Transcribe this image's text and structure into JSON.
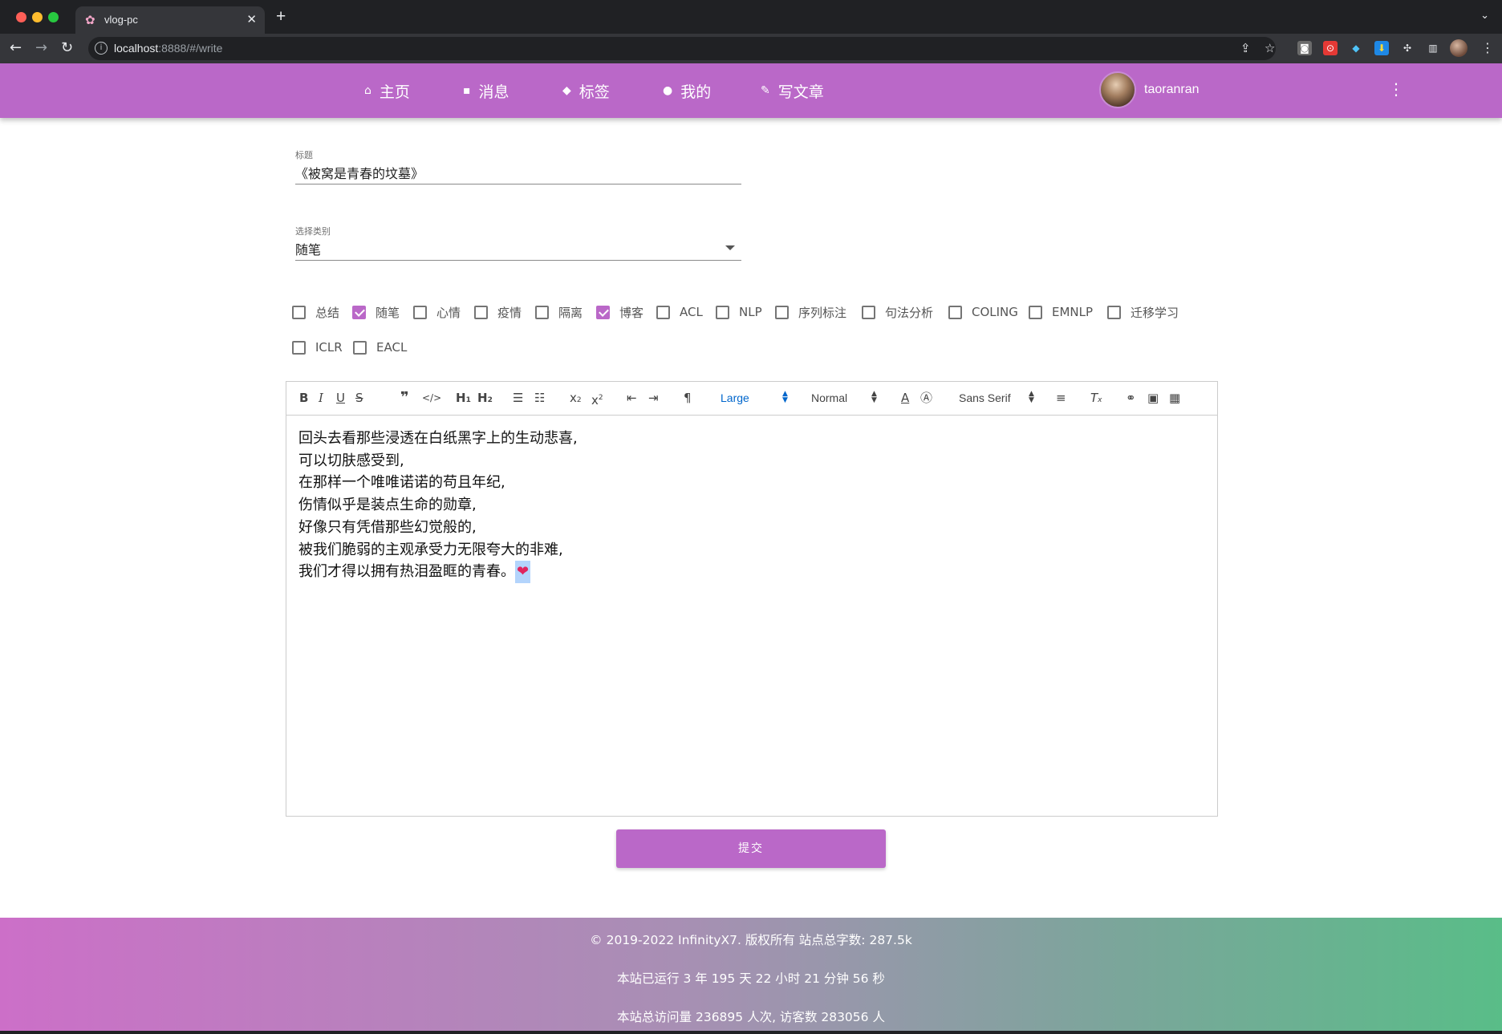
{
  "browser": {
    "tab_title": "vlog-pc",
    "tab_favicon": "✿",
    "url_host": "localhost",
    "url_rest": ":8888/#/write"
  },
  "nav": {
    "items": [
      {
        "label": "主页",
        "icon": "home-icon",
        "glyph": "⌂"
      },
      {
        "label": "消息",
        "icon": "message-icon",
        "glyph": "▪"
      },
      {
        "label": "标签",
        "icon": "tag-icon",
        "glyph": "◆"
      },
      {
        "label": "我的",
        "icon": "person-icon",
        "glyph": "●"
      },
      {
        "label": "写文章",
        "icon": "pencil-icon",
        "glyph": "✎"
      }
    ],
    "username": "taoranran",
    "accent_color": "#ba68c8"
  },
  "form": {
    "title_label": "标题",
    "title_value": "《被窝是青春的坟墓》",
    "category_label": "选择类别",
    "category_value": "随笔"
  },
  "tags": [
    {
      "label": "总结",
      "checked": false
    },
    {
      "label": "随笔",
      "checked": true
    },
    {
      "label": "心情",
      "checked": false
    },
    {
      "label": "疫情",
      "checked": false
    },
    {
      "label": "隔离",
      "checked": false
    },
    {
      "label": "博客",
      "checked": true
    },
    {
      "label": "ACL",
      "checked": false
    },
    {
      "label": "NLP",
      "checked": false
    },
    {
      "label": "序列标注",
      "checked": false
    },
    {
      "label": "句法分析",
      "checked": false
    },
    {
      "label": "COLING",
      "checked": false
    },
    {
      "label": "EMNLP",
      "checked": false
    },
    {
      "label": "迁移学习",
      "checked": false
    },
    {
      "label": "ICLR",
      "checked": false
    },
    {
      "label": "EACL",
      "checked": false
    }
  ],
  "editor": {
    "size_select": "Large",
    "header_select": "Normal",
    "font_select": "Sans Serif",
    "lines": [
      "回头去看那些浸透在白纸黑字上的生动悲喜,",
      "可以切肤感受到,",
      "在那样一个唯唯诺诺的苟且年纪,",
      "伤情似乎是装点生命的勋章,",
      "好像只有凭借那些幻觉般的,",
      "被我们脆弱的主观承受力无限夸大的非难,",
      "我们才得以拥有热泪盈眶的青春。"
    ],
    "last_emoji": "❤"
  },
  "submit_label": "提交",
  "footer": {
    "copyright": "© 2019-2022 InfinityX7. 版权所有 站点总字数: 287.5k",
    "uptime": "本站已运行 3 年 195 天 22 小时 21 分钟 56 秒",
    "visits": "本站总访问量 236895 人次, 访客数 283056 人"
  }
}
